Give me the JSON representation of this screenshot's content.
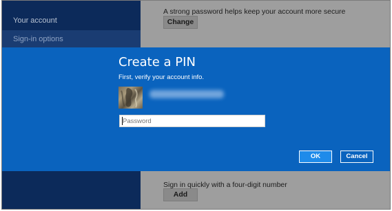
{
  "sidebar": {
    "items": [
      {
        "label": "Your account"
      },
      {
        "label": "Sign-in options"
      }
    ]
  },
  "content": {
    "password_hint": "A strong password helps keep your account more secure",
    "change_label": "Change",
    "pin_hint": "Sign in quickly with a four-digit number",
    "add_label": "Add"
  },
  "dialog": {
    "title": "Create a PIN",
    "subtitle": "First, verify your account info.",
    "password_placeholder": "Password",
    "ok_label": "OK",
    "cancel_label": "Cancel"
  },
  "colors": {
    "sidebar_bg": "#0c2a5a",
    "dialog_bg": "#0a63be",
    "ok_button": "#1e8bea",
    "overlay": "#9e9e9e"
  }
}
